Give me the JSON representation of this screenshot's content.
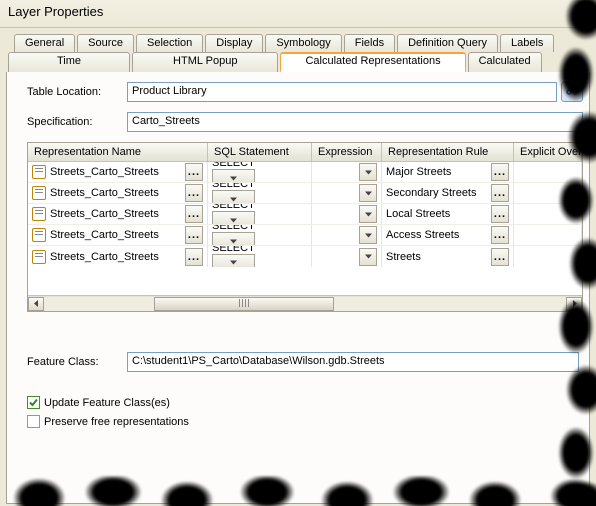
{
  "title": "Layer Properties",
  "tabs_row1": [
    "General",
    "Source",
    "Selection",
    "Display",
    "Symbology",
    "Fields",
    "Definition Query",
    "Labels"
  ],
  "tabs_row2": [
    {
      "label": "Time",
      "active": false
    },
    {
      "label": "HTML Popup",
      "active": false
    },
    {
      "label": "Calculated Representations",
      "active": true
    },
    {
      "label": "Calculated",
      "active": false
    }
  ],
  "fields": {
    "table_location_label": "Table Location:",
    "table_location_value": "Product Library",
    "specification_label": "Specification:",
    "specification_value": "Carto_Streets",
    "feature_class_label": "Feature Class:",
    "feature_class_value": "C:\\student1\\PS_Carto\\Database\\Wilson.gdb.Streets"
  },
  "grid": {
    "headers": {
      "name": "Representation Name",
      "sql": "SQL Statement",
      "expr": "Expression",
      "rule": "Representation Rule",
      "over": "Explicit Override"
    },
    "rows": [
      {
        "name": "Streets_Carto_Streets",
        "sql": "SELECT <Targe",
        "rule": "Major Streets"
      },
      {
        "name": "Streets_Carto_Streets",
        "sql": "SELECT <Targe",
        "rule": "Secondary Streets"
      },
      {
        "name": "Streets_Carto_Streets",
        "sql": "SELECT <Targe",
        "rule": "Local Streets"
      },
      {
        "name": "Streets_Carto_Streets",
        "sql": "SELECT <Targe",
        "rule": "Access Streets"
      },
      {
        "name": "Streets_Carto_Streets",
        "sql": "SELECT <Targe",
        "rule": "Streets"
      }
    ]
  },
  "checks": {
    "update_label": "Update Feature Class(es)",
    "update_checked": true,
    "preserve_label": "Preserve free representations",
    "preserve_checked": false
  }
}
